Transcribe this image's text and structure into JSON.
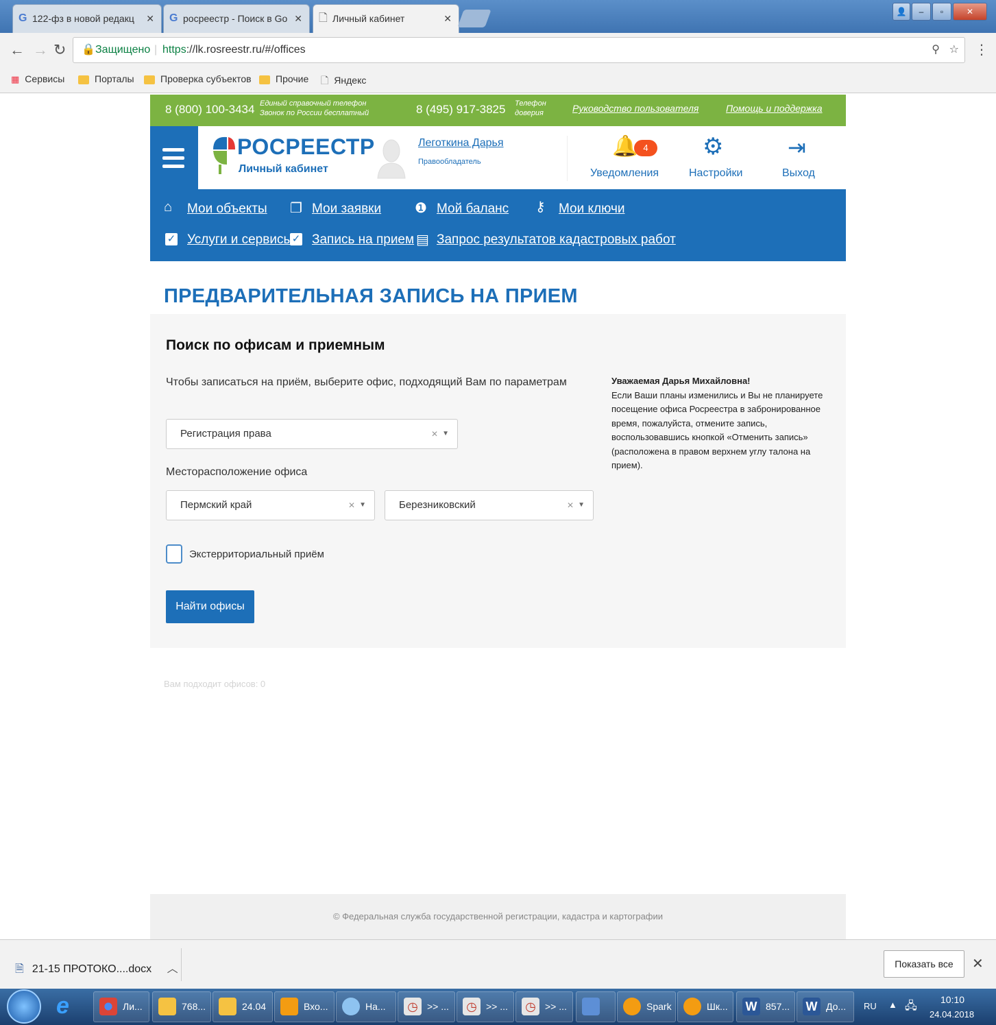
{
  "browser": {
    "tabs": [
      {
        "title": "122-фз в новой редакц"
      },
      {
        "title": "росреестр - Поиск в Go"
      },
      {
        "title": "Личный кабинет"
      }
    ],
    "secure_label": "Защищено",
    "url_scheme": "https",
    "url_rest": "://lk.rosreestr.ru/#/offices",
    "bookmarks": [
      "Сервисы",
      "Порталы",
      "Проверка субъектов",
      "Прочие",
      "Яндекс"
    ]
  },
  "site": {
    "hotline_phone": "8 (800) 100-3434",
    "hotline_note_1": "Единый справочный телефон",
    "hotline_note_2": "Звонок по России бесплатный",
    "support_phone": "8 (495) 917-3825",
    "support_note_1": "Телефон",
    "support_note_2": "доверия",
    "guide_link": "Руководство пользователя",
    "help_link": "Помощь и поддержка",
    "logo_title": "РОСРЕЕСТР",
    "logo_subtitle": "Личный кабинет",
    "user_name": "Леготкина Дарья",
    "user_role": "Правообладатель",
    "notifications_label": "Уведомления",
    "notifications_count": "4",
    "settings_label": "Настройки",
    "logout_label": "Выход",
    "nav": {
      "my_objects": "Мои объекты",
      "my_requests": "Мои заявки",
      "my_balance": "Мой баланс",
      "my_keys": "Мои ключи",
      "services": "Услуги и сервисы",
      "appointment": "Запись на прием",
      "cadastral": "Запрос результатов кадастровых работ"
    }
  },
  "page": {
    "title": "ПРЕДВАРИТЕЛЬНАЯ ЗАПИСЬ НА ПРИЕМ",
    "panel_title": "Поиск по офисам и приемным",
    "instruction": "Чтобы записаться на приём, выберите офис, подходящий Вам по параметрам",
    "service_select": "Регистрация права",
    "location_label": "Месторасположение офиса",
    "region_select": "Пермский край",
    "district_select": "Березниковский",
    "exterritorial_label": "Экстерриториальный приём",
    "find_button": "Найти офисы",
    "notice_greeting": "Уважаемая Дарья Михайловна!",
    "notice_text": "Если Ваши планы изменились и Вы не планируете посещение офиса Росреестра в забронированное время, пожалуйста, отмените запись, воспользовавшись кнопкой «Отменить запись» (расположена в правом верхнем углу талона на прием).",
    "found_text": "Вам подходит офисов: 0",
    "footer": "© Федеральная служба государственной регистрации, кадастра и картографии"
  },
  "downloads": {
    "file": "21-15 ПРОТОКО....docx",
    "show_all": "Показать все"
  },
  "taskbar": {
    "items": [
      "Ли...",
      "768...",
      "24.04",
      "Вхо...",
      "На...",
      ">> ...",
      ">> ...",
      ">> ...",
      "Spark",
      "Шк...",
      "857...",
      "До..."
    ],
    "lang": "RU",
    "time": "10:10",
    "date": "24.04.2018"
  }
}
